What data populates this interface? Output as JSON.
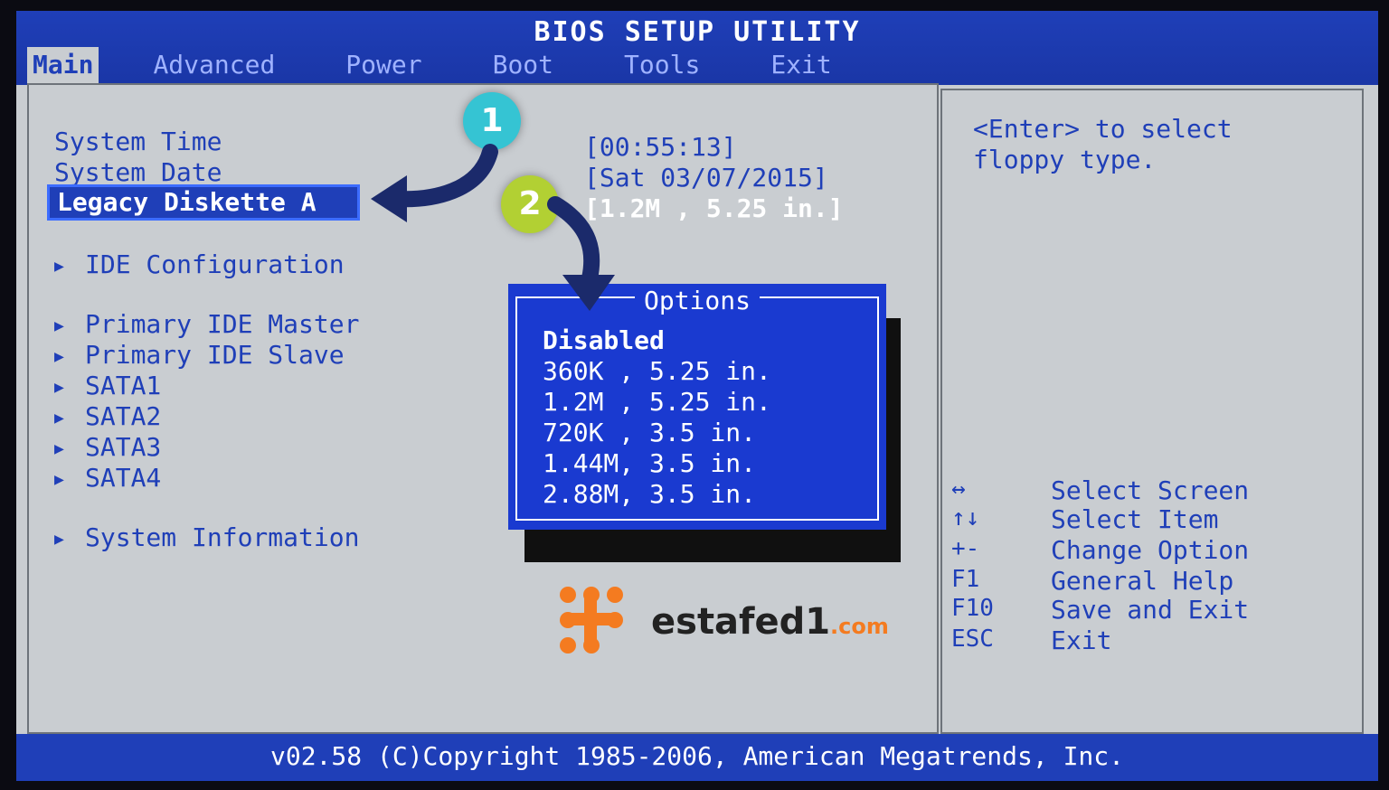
{
  "window": {
    "title": "BIOS SETUP UTILITY"
  },
  "tabs": [
    {
      "label": "Main",
      "active": true
    },
    {
      "label": "Advanced"
    },
    {
      "label": "Power"
    },
    {
      "label": "Boot"
    },
    {
      "label": "Tools"
    },
    {
      "label": "Exit"
    }
  ],
  "main": {
    "items": [
      {
        "label": "System Time",
        "value": "[00:55:13]"
      },
      {
        "label": "System Date",
        "value": "[Sat 03/07/2015]"
      },
      {
        "label": "Legacy Diskette A",
        "value": "[1.2M , 5.25 in.]",
        "selected": true
      }
    ],
    "submenus": [
      "IDE Configuration",
      "Primary IDE Master",
      "Primary IDE Slave",
      "SATA1",
      "SATA2",
      "SATA3",
      "SATA4",
      "System Information"
    ]
  },
  "popup": {
    "title": "Options",
    "options": [
      "Disabled",
      "360K , 5.25 in.",
      "1.2M , 5.25 in.",
      "720K , 3.5 in.",
      "1.44M, 3.5 in.",
      "2.88M, 3.5 in."
    ],
    "highlighted_index": 0
  },
  "help": {
    "description_lines": [
      "<Enter> to select",
      "floppy type."
    ],
    "keys": [
      {
        "key": "↔",
        "desc": "Select Screen"
      },
      {
        "key": "↑↓",
        "desc": "Select Item"
      },
      {
        "key": "+-",
        "desc": "Change Option"
      },
      {
        "key": "F1",
        "desc": "General Help"
      },
      {
        "key": "F10",
        "desc": "Save and Exit"
      },
      {
        "key": "ESC",
        "desc": "Exit"
      }
    ]
  },
  "footer": {
    "text": "v02.58 (C)Copyright 1985-2006, American Megatrends, Inc."
  },
  "annotations": {
    "badge_1": "1",
    "badge_2": "2"
  },
  "watermark": {
    "name": "estafed1",
    "tld": ".com",
    "brand_color": "#f47b20"
  },
  "colors": {
    "bios_blue": "#1f3fb8",
    "panel_gray": "#c9cdd1",
    "popup_blue": "#1a3ad0",
    "badge_1": "#35c4d3",
    "badge_2": "#b2d033"
  }
}
